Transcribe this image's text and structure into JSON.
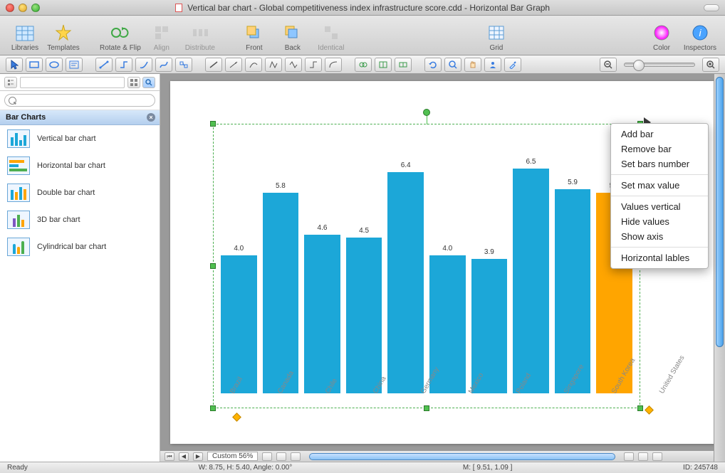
{
  "title": "Vertical bar chart - Global competitiveness index infrastructure score.cdd - Horizontal Bar Graph",
  "toolbar": {
    "libraries": "Libraries",
    "templates": "Templates",
    "rotate_flip": "Rotate & Flip",
    "align": "Align",
    "distribute": "Distribute",
    "front": "Front",
    "back": "Back",
    "identical": "Identical",
    "grid": "Grid",
    "color": "Color",
    "inspectors": "Inspectors"
  },
  "sidebar": {
    "search_placeholder": "",
    "header": "Bar Charts",
    "items": [
      {
        "label": "Vertical bar chart"
      },
      {
        "label": "Horizontal bar chart"
      },
      {
        "label": "Double bar chart"
      },
      {
        "label": "3D bar chart"
      },
      {
        "label": "Cylindrical bar chart"
      }
    ]
  },
  "context_menu": {
    "add_bar": "Add bar",
    "remove_bar": "Remove bar",
    "set_bars_number": "Set bars number",
    "set_max_value": "Set max value",
    "values_vertical": "Values vertical",
    "hide_values": "Hide values",
    "show_axis": "Show axis",
    "horizontal_labels": "Horizontal lables"
  },
  "bottom": {
    "zoom_label": "Custom 56%"
  },
  "status": {
    "ready": "Ready",
    "dims": "W: 8.75,  H: 5.40,  Angle: 0.00°",
    "mouse": "M: [ 9.51, 1.09 ]",
    "id": "ID: 245748"
  },
  "chart_data": {
    "type": "bar",
    "title": "",
    "xlabel": "",
    "ylabel": "",
    "ylim": [
      0,
      7
    ],
    "categories": [
      "Brazil",
      "Canada",
      "Chile",
      "China",
      "Germany",
      "Mexico",
      "Poland",
      "Singapore",
      "South Korea",
      "United States"
    ],
    "values": [
      4.0,
      5.8,
      4.6,
      4.5,
      6.4,
      4.0,
      3.9,
      6.5,
      5.9,
      5.8
    ],
    "highlight_index": 9,
    "colors": {
      "default": "#1ca7d8",
      "highlight": "#ffa500"
    }
  }
}
